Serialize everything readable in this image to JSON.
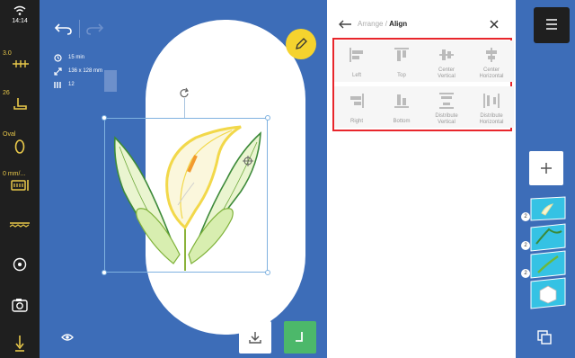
{
  "status": {
    "time": "14:14",
    "stitch_length": "3.0",
    "presser_foot": "26",
    "hoop": "Oval",
    "speed": "0 mm/..."
  },
  "design_info": {
    "time": "15 min",
    "size": "136 x 128 mm",
    "colors": "12"
  },
  "dialog": {
    "breadcrumb_parent": "Arrange",
    "separator": "/",
    "title": "Align",
    "buttons": [
      {
        "label": "Left"
      },
      {
        "label": "Top"
      },
      {
        "label": "Center\nVertical"
      },
      {
        "label": "Center\nHorizontal"
      },
      {
        "label": "Right"
      },
      {
        "label": "Bottom"
      },
      {
        "label": "Distribute\nVertical"
      },
      {
        "label": "Distribute\nHorizontal"
      }
    ]
  },
  "layers": {
    "badges": [
      "2",
      "2",
      "2"
    ]
  },
  "colors": {
    "canvas_bg": "#3d6db8",
    "sidebar_bg": "#1f1f1f",
    "accent_yellow": "#f5d32e",
    "accent_green": "#4cb86a",
    "highlight_red": "#e8262c",
    "sidebar_icon_yellow": "#e8c84a"
  }
}
